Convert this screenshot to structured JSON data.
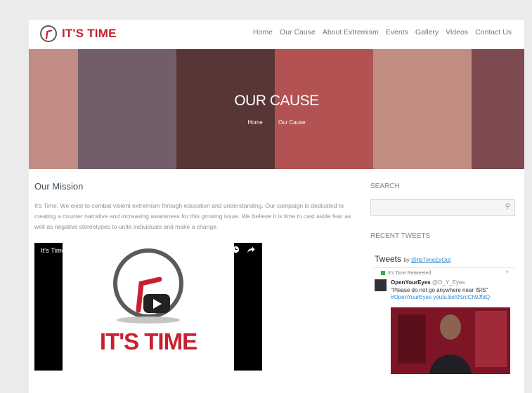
{
  "brand": {
    "name": "IT'S TIME",
    "color": "#c8202f"
  },
  "nav": [
    "Home",
    "Our Cause",
    "About Extremism",
    "Events",
    "Gallery",
    "Videos",
    "Contact Us"
  ],
  "hero": {
    "title": "OUR CAUSE",
    "breadcrumb": [
      "Home",
      "Our Cause"
    ]
  },
  "main": {
    "title": "Our Mission",
    "text": "It's Time: We exist to combat violent extremism through education and understanding. Our campaign is dedicated to creating a counter narrative and increasing awareness for this growing issue. We believe it is time to cast aside fear as well as negative stereotypes to unite individuals and make a change."
  },
  "video": {
    "title": "It's Time: ExOut Extremism",
    "brand_text": "IT'S TIME",
    "icons": [
      "clock-icon",
      "share-icon",
      "play-icon"
    ]
  },
  "sidebar": {
    "search_label": "SEARCH",
    "search_placeholder": "",
    "recent_label": "RECENT TWEETS",
    "tweets": {
      "title": "Tweets",
      "by": "by",
      "handle": "@ItsTimeExOut",
      "retweet_label": "It's Time Retweeted",
      "author": "OpenYourEyes",
      "author_handle": "@O_Y_Eyes",
      "text": "\"Please do not go anywhere near ISIS\"",
      "link": "#OpenYourEyes youtu.be/0SnICh9JfdQ"
    }
  }
}
